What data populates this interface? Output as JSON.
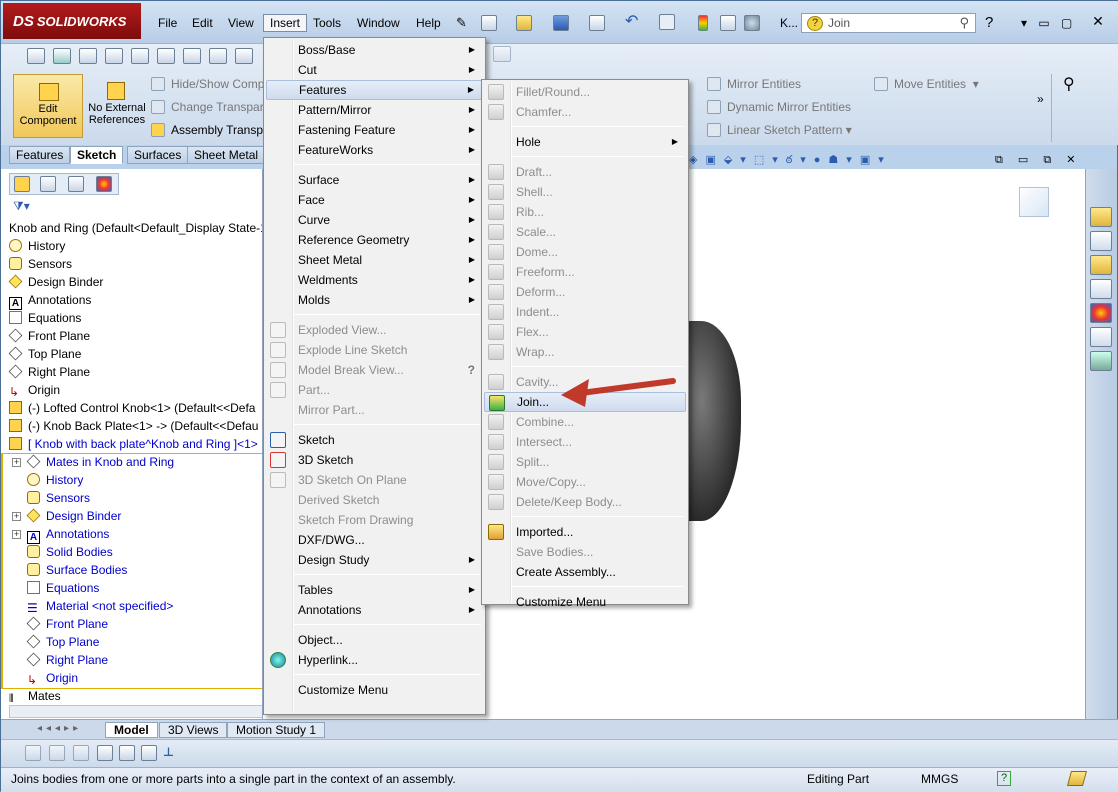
{
  "app": {
    "logo": "SOLIDWORKS",
    "logo_mark": "DS",
    "search_placeholder": "Join"
  },
  "menubar": [
    {
      "label": "File"
    },
    {
      "label": "Edit"
    },
    {
      "label": "View"
    },
    {
      "label": "Insert",
      "active": true
    },
    {
      "label": "Tools"
    },
    {
      "label": "Window"
    },
    {
      "label": "Help"
    }
  ],
  "titlebar_extra": "K...",
  "cmd": {
    "edit_component": "Edit Component",
    "no_external": "No External References",
    "hide_show": "Hide/Show Comp",
    "change_transp": "Change Transpar",
    "assembly_transp": "Assembly Transpa",
    "mirror_entities": "Mirror Entities",
    "dynamic_mirror": "Dynamic Mirror Entities",
    "linear_pattern": "Linear Sketch Pattern",
    "move_entities": "Move Entities",
    "partial_1": "et",
    "partial_2": "es"
  },
  "tabs": [
    {
      "label": "Features"
    },
    {
      "label": "Sketch",
      "selected": true
    },
    {
      "label": "Surfaces"
    },
    {
      "label": "Sheet Metal"
    }
  ],
  "tree": {
    "root": "Knob and Ring  (Default<Default_Display State-1",
    "items": [
      {
        "label": "History"
      },
      {
        "label": "Sensors"
      },
      {
        "label": "Design Binder"
      },
      {
        "label": "Annotations"
      },
      {
        "label": "Equations"
      },
      {
        "label": "Front Plane"
      },
      {
        "label": "Top Plane"
      },
      {
        "label": "Right Plane"
      },
      {
        "label": "Origin"
      },
      {
        "label": "(-) Lofted Control Knob<1> (Default<<Defa"
      },
      {
        "label": "(-) Knob Back Plate<1> -> (Default<<Defau"
      },
      {
        "label": "[ Knob with back plate^Knob and Ring ]<1>"
      }
    ],
    "sub": [
      {
        "label": "Mates in Knob and Ring"
      },
      {
        "label": "History"
      },
      {
        "label": "Sensors"
      },
      {
        "label": "Design Binder"
      },
      {
        "label": "Annotations"
      },
      {
        "label": "Solid Bodies"
      },
      {
        "label": "Surface Bodies"
      },
      {
        "label": "Equations"
      },
      {
        "label": "Material <not specified>"
      },
      {
        "label": "Front Plane"
      },
      {
        "label": "Top Plane"
      },
      {
        "label": "Right Plane"
      },
      {
        "label": "Origin"
      }
    ],
    "mates": "Mates"
  },
  "insert_menu": {
    "items": [
      {
        "label": "Boss/Base",
        "sub": true
      },
      {
        "label": "Cut",
        "sub": true
      },
      {
        "label": "Features",
        "sub": true,
        "hl": true
      },
      {
        "label": "Pattern/Mirror",
        "sub": true
      },
      {
        "label": "Fastening Feature",
        "sub": true
      },
      {
        "label": "FeatureWorks",
        "sub": true
      },
      {
        "label": "Surface",
        "sub": true
      },
      {
        "label": "Face",
        "sub": true
      },
      {
        "label": "Curve",
        "sub": true
      },
      {
        "label": "Reference Geometry",
        "sub": true
      },
      {
        "label": "Sheet Metal",
        "sub": true
      },
      {
        "label": "Weldments",
        "sub": true
      },
      {
        "label": "Molds",
        "sub": true
      },
      {
        "label": "Exploded View...",
        "dis": true
      },
      {
        "label": "Explode Line Sketch",
        "dis": true
      },
      {
        "label": "Model Break View...",
        "dis": true
      },
      {
        "label": "Part...",
        "dis": true
      },
      {
        "label": "Mirror Part...",
        "dis": true
      },
      {
        "label": "Sketch"
      },
      {
        "label": "3D Sketch"
      },
      {
        "label": "3D Sketch On Plane",
        "dis": true
      },
      {
        "label": "Derived Sketch",
        "dis": true
      },
      {
        "label": "Sketch From Drawing",
        "dis": true
      },
      {
        "label": "DXF/DWG..."
      },
      {
        "label": "Design Study",
        "sub": true
      },
      {
        "label": "Tables",
        "sub": true
      },
      {
        "label": "Annotations",
        "sub": true
      },
      {
        "label": "Object..."
      },
      {
        "label": "Hyperlink..."
      },
      {
        "label": "Customize Menu"
      }
    ]
  },
  "features_menu": {
    "items": [
      {
        "label": "Fillet/Round...",
        "dis": true
      },
      {
        "label": "Chamfer...",
        "dis": true
      },
      {
        "label": "Hole",
        "sub": true
      },
      {
        "label": "Draft...",
        "dis": true
      },
      {
        "label": "Shell...",
        "dis": true
      },
      {
        "label": "Rib...",
        "dis": true
      },
      {
        "label": "Scale...",
        "dis": true
      },
      {
        "label": "Dome...",
        "dis": true
      },
      {
        "label": "Freeform...",
        "dis": true
      },
      {
        "label": "Deform...",
        "dis": true
      },
      {
        "label": "Indent...",
        "dis": true
      },
      {
        "label": "Flex...",
        "dis": true
      },
      {
        "label": "Wrap...",
        "dis": true
      },
      {
        "label": "Cavity...",
        "dis": true
      },
      {
        "label": "Join...",
        "hl": true
      },
      {
        "label": "Combine...",
        "dis": true
      },
      {
        "label": "Intersect...",
        "dis": true
      },
      {
        "label": "Split...",
        "dis": true
      },
      {
        "label": "Move/Copy...",
        "dis": true
      },
      {
        "label": "Delete/Keep Body...",
        "dis": true
      },
      {
        "label": "Imported..."
      },
      {
        "label": "Save Bodies...",
        "dis": true
      },
      {
        "label": "Create Assembly..."
      },
      {
        "label": "Customize Menu"
      }
    ]
  },
  "bottom_tabs": [
    {
      "label": "Model",
      "selected": true
    },
    {
      "label": "3D Views"
    },
    {
      "label": "Motion Study 1"
    }
  ],
  "status": {
    "message": "Joins bodies from one or more parts into a single part in the context of an assembly.",
    "mode": "Editing Part",
    "units": "MMGS",
    "help": "?"
  },
  "colors": {
    "arrow": "#c0392b",
    "tree_blue": "#0000cc",
    "highlight": "#cfdcee"
  }
}
